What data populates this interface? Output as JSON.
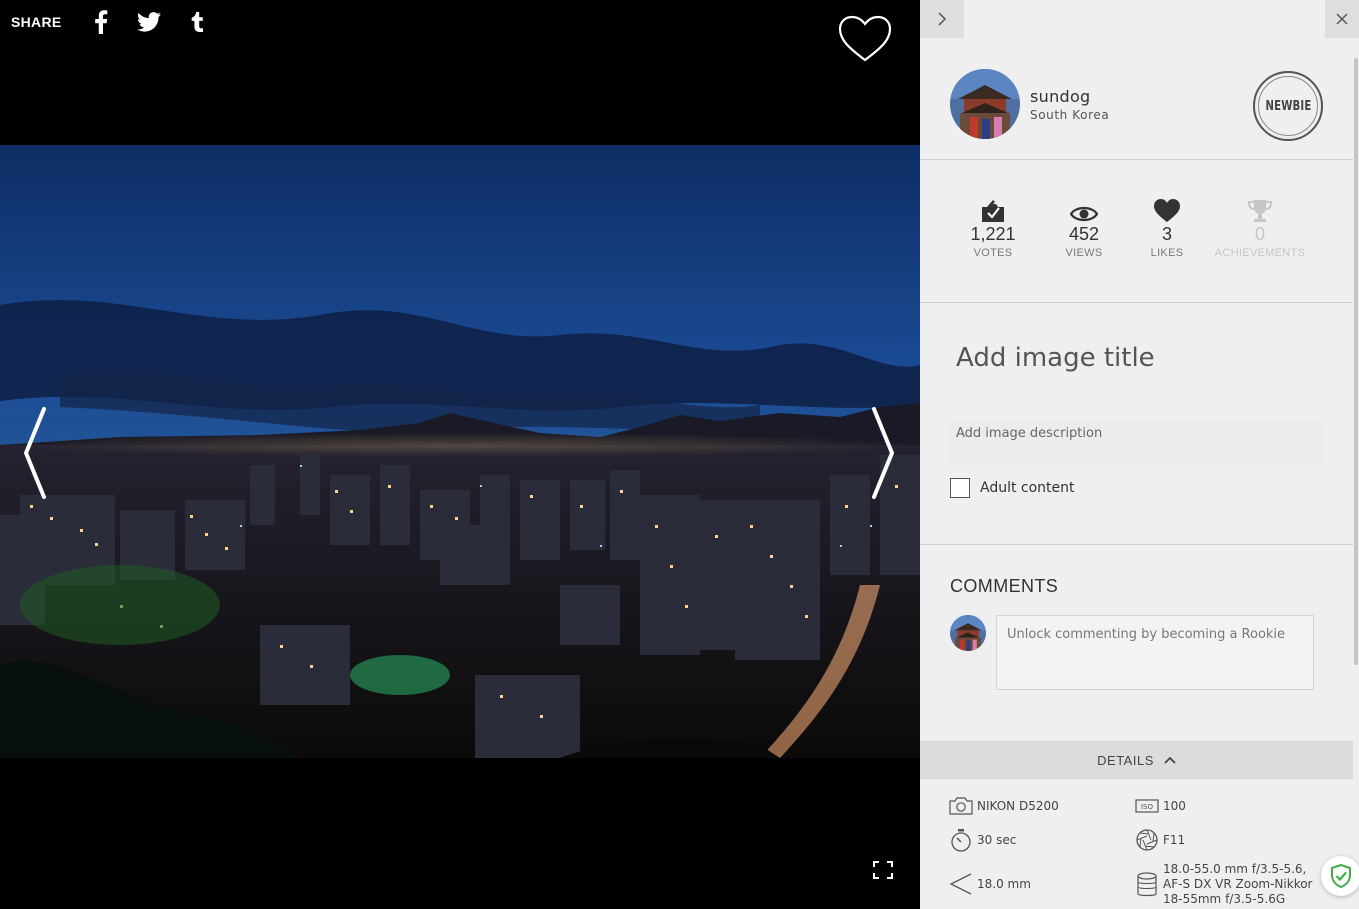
{
  "share": {
    "label": "SHARE",
    "networks": [
      {
        "icon": "facebook-icon"
      },
      {
        "icon": "twitter-icon"
      },
      {
        "icon": "tumblr-icon"
      }
    ]
  },
  "viewer": {
    "like_icon": "heart-outline-icon",
    "prev_icon": "chevron-left-icon",
    "next_icon": "chevron-right-icon",
    "fullscreen_icon": "fullscreen-icon"
  },
  "user": {
    "name": "sundog",
    "location": "South Korea",
    "level": "NEWBIE"
  },
  "stats": [
    {
      "icon": "votes-icon",
      "value": "1,221",
      "label": "VOTES"
    },
    {
      "icon": "eye-icon",
      "value": "452",
      "label": "VIEWS"
    },
    {
      "icon": "heart-icon",
      "value": "3",
      "label": "LIKES"
    },
    {
      "icon": "trophy-icon",
      "value": "0",
      "label": "ACHIEVEMENTS"
    }
  ],
  "form": {
    "title_placeholder": "Add image title",
    "description_placeholder": "Add image description",
    "adult_label": "Adult content",
    "adult_checked": false
  },
  "comments": {
    "title": "COMMENTS",
    "placeholder": "Unlock commenting by becoming a Rookie"
  },
  "details": {
    "label": "DETAILS",
    "camera": "NIKON D5200",
    "iso": "100",
    "shutter": "30 sec",
    "aperture": "F11",
    "focal_length": "18.0 mm",
    "lens": "18.0-55.0 mm f/3.5-5.6, AF-S DX VR Zoom-Nikkor 18-55mm f/3.5-5.6G"
  },
  "colors": {
    "panel_bg": "#efefef",
    "viewer_bg": "#000000",
    "shield_green": "#3fae49"
  }
}
